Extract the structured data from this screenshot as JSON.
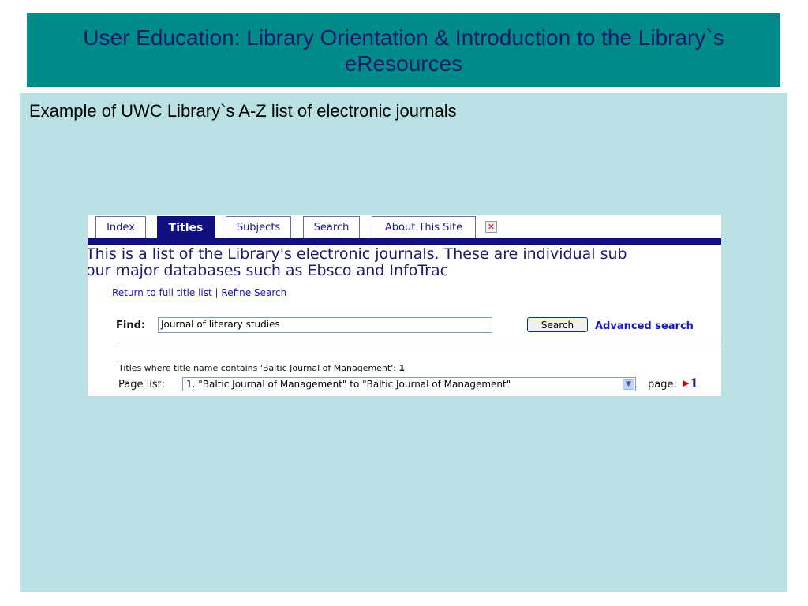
{
  "slide": {
    "title": "User Education: Library Orientation & Introduction to the Library`s eResources",
    "subtitle": "Example of UWC Library`s A-Z list of electronic journals"
  },
  "screenshot": {
    "tabs": [
      "Index",
      "Titles",
      "Subjects",
      "Search",
      "About This Site"
    ],
    "active_tab": "Titles",
    "close_icon": "close-icon",
    "intro_line1": "This is a list of the Library's electronic journals. These are individual sub",
    "intro_line2": "our major databases such as Ebsco and InfoTrac",
    "links": {
      "return": "Return to full title list",
      "separator": "|",
      "refine": "Refine Search"
    },
    "find": {
      "label": "Find:",
      "value": "Journal of literary studies",
      "button": "Search",
      "advanced": "Advanced search"
    },
    "results": {
      "text": "Titles where title name contains 'Baltic Journal of Management':",
      "count": "1"
    },
    "page_list": {
      "label": "Page list:",
      "selected": "1. \"Baltic Journal of Management\" to \"Baltic Journal of Management\"",
      "page_label": "page:",
      "page_number": "1"
    },
    "colors": {
      "nav": "#101080",
      "title_bar": "#008b8b",
      "content_bg": "#b9e0e2"
    }
  }
}
